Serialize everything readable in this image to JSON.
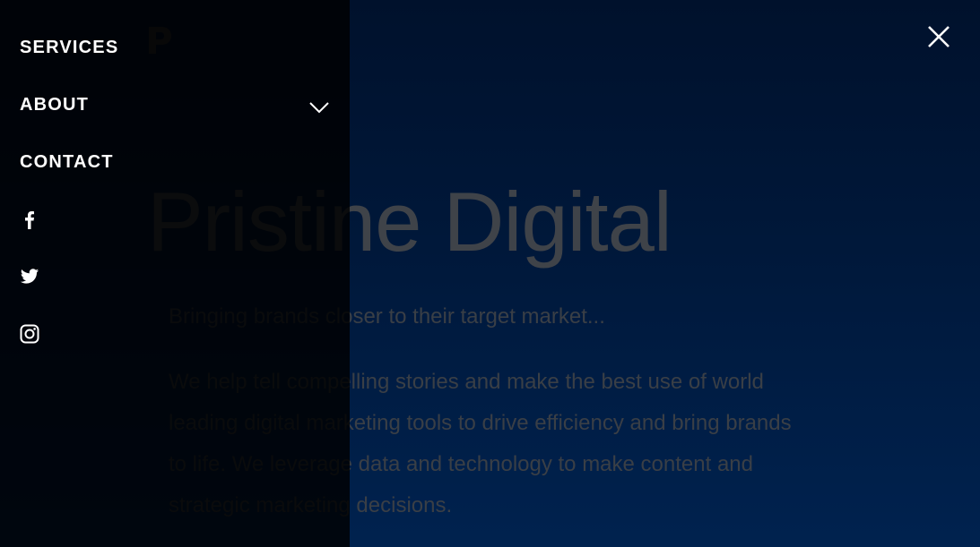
{
  "hero": {
    "title": "Pristine Digital",
    "tagline": "Bringing brands closer to their target market...",
    "description": "We help tell compelling stories and make the best use of world leading digital marketing tools to drive efficiency and bring brands to life. We leverage data and technology to make content and strategic marketing decisions."
  },
  "menu": {
    "items": [
      {
        "label": "SERVICES"
      },
      {
        "label": "ABOUT",
        "has_submenu": true,
        "icon": "chevron-down-icon"
      },
      {
        "label": "CONTACT"
      }
    ],
    "social": [
      {
        "icon": "facebook-icon"
      },
      {
        "icon": "twitter-icon"
      },
      {
        "icon": "instagram-icon"
      }
    ]
  },
  "close_icon": "close-icon",
  "colors": {
    "background_top": "#00112c",
    "background_bottom": "#00224f",
    "menu_text": "#ffffff",
    "dimmed_text": "#3f4349"
  }
}
